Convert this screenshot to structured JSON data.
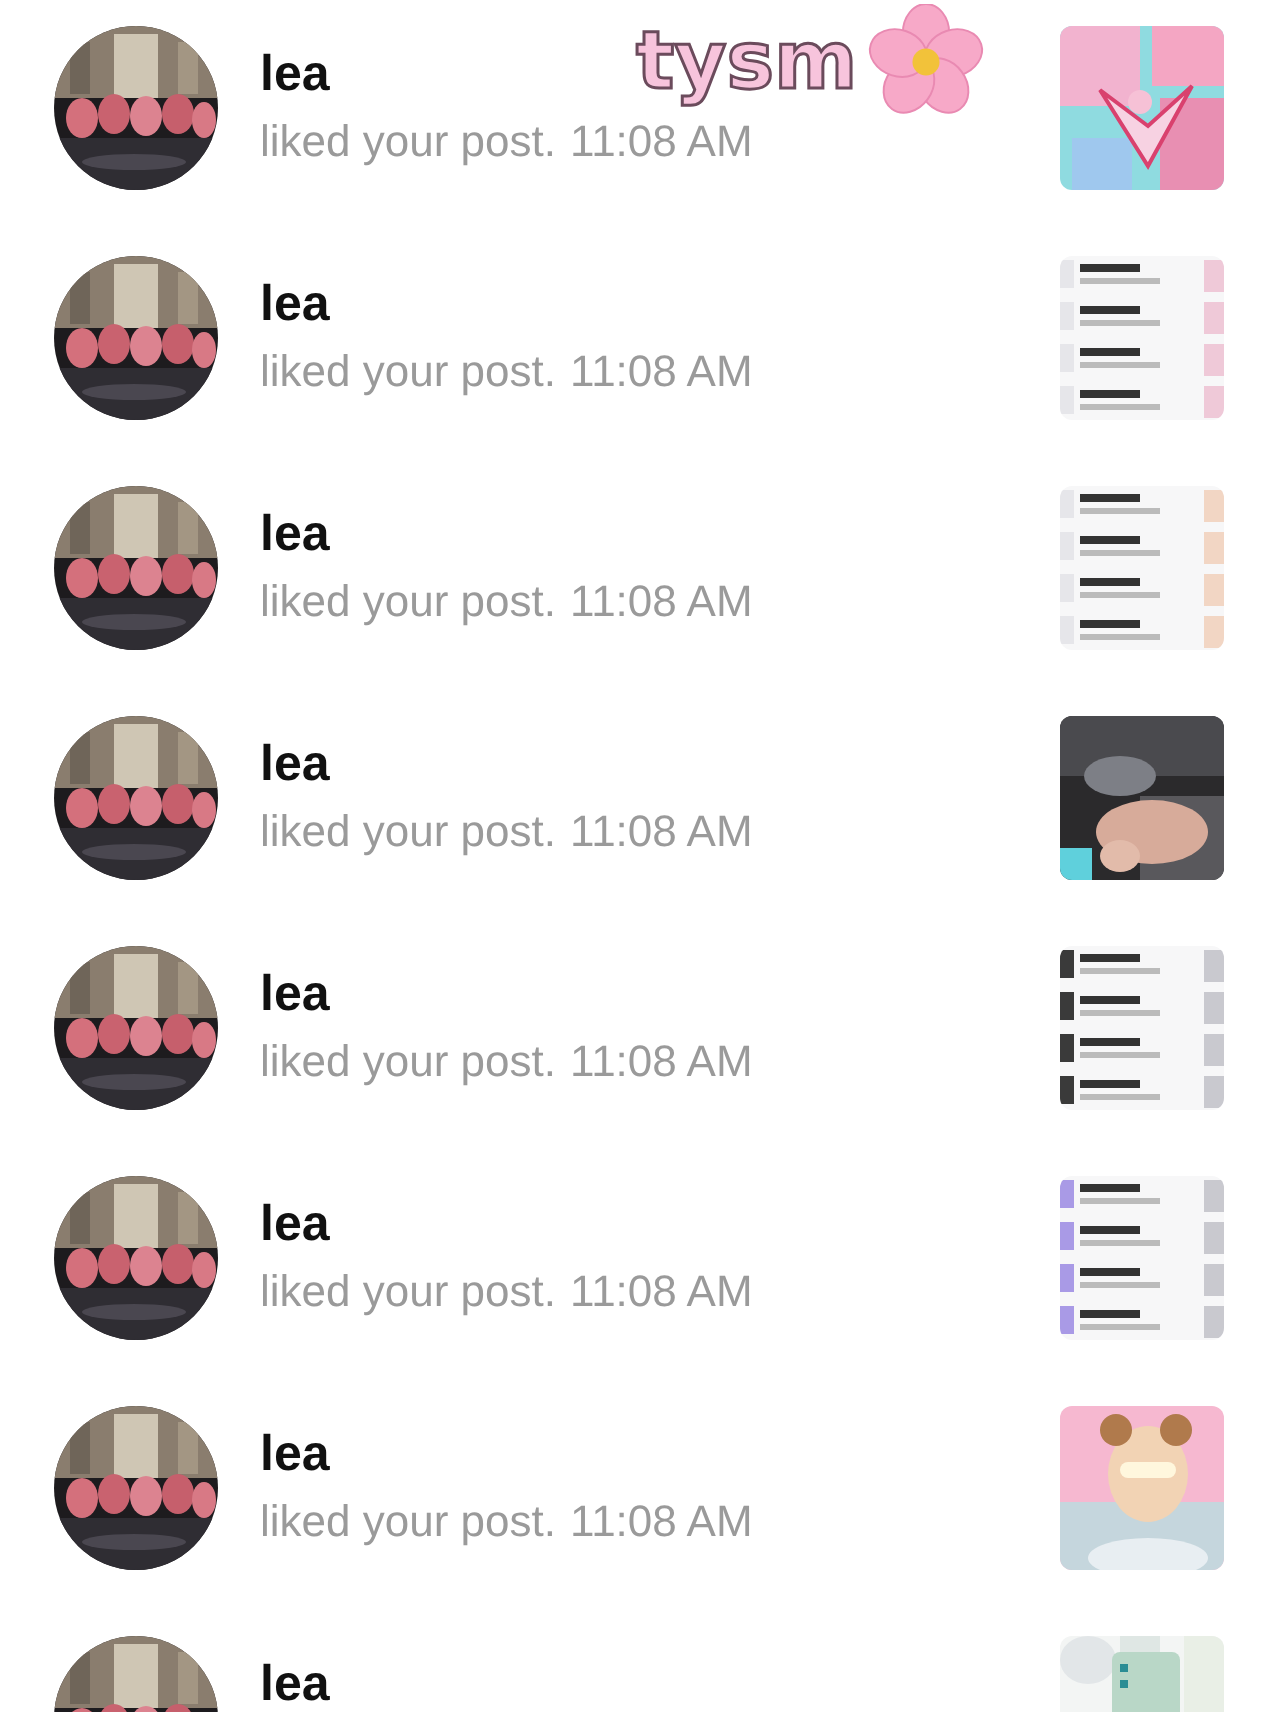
{
  "sticker": {
    "text": "tysm"
  },
  "notifications": [
    {
      "name": "lea",
      "text": "liked your post.",
      "time": "11:08 AM"
    },
    {
      "name": "lea",
      "text": "liked your post.",
      "time": "11:08 AM"
    },
    {
      "name": "lea",
      "text": "liked your post.",
      "time": "11:08 AM"
    },
    {
      "name": "lea",
      "text": "liked your post.",
      "time": "11:08 AM"
    },
    {
      "name": "lea",
      "text": "liked your post.",
      "time": "11:08 AM"
    },
    {
      "name": "lea",
      "text": "liked your post.",
      "time": "11:08 AM"
    },
    {
      "name": "lea",
      "text": "liked your post.",
      "time": "11:08 AM"
    },
    {
      "name": "lea"
    }
  ]
}
